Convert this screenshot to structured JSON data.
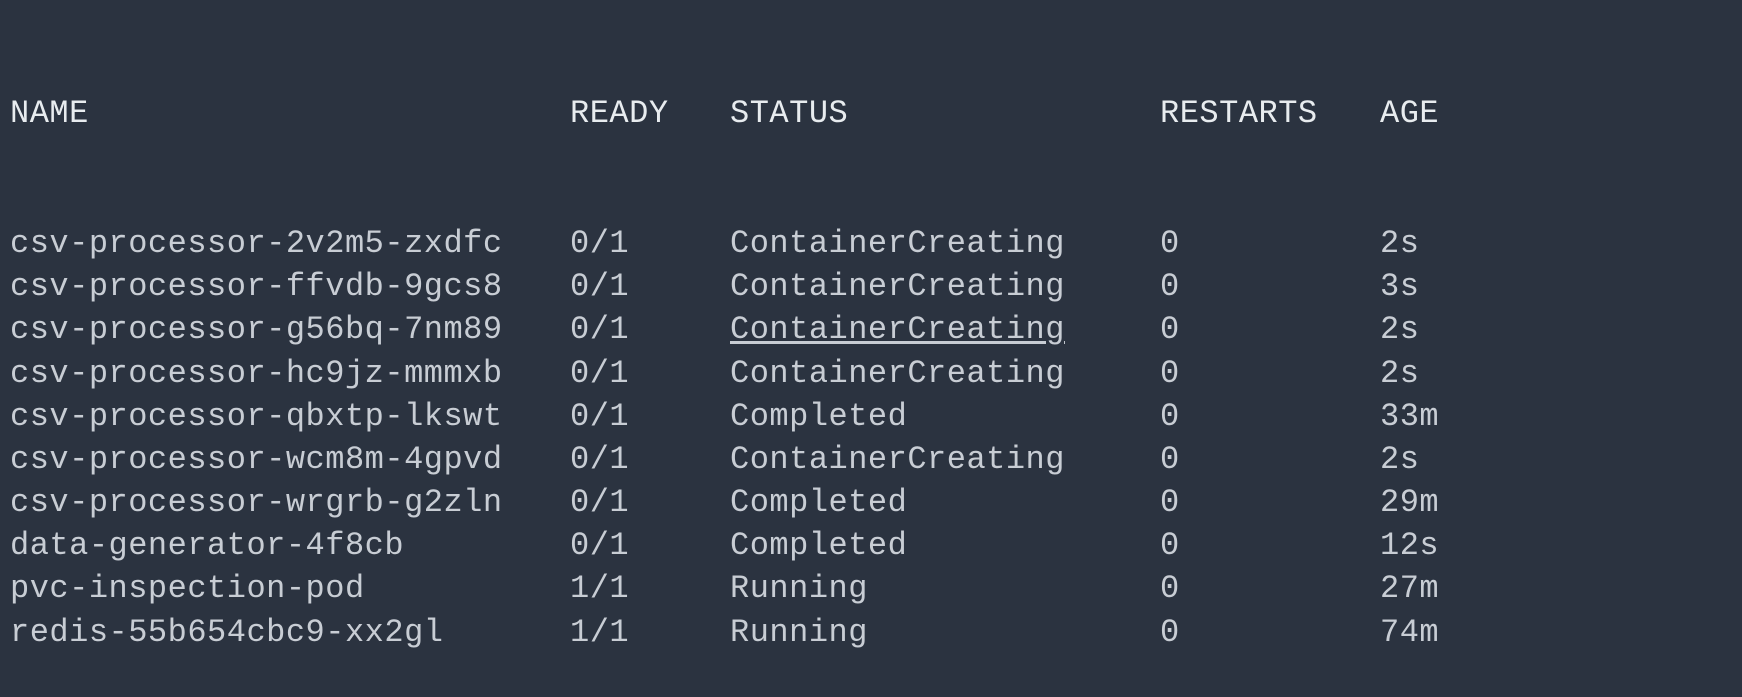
{
  "headers": {
    "name": "NAME",
    "ready": "READY",
    "status": "STATUS",
    "restarts": "RESTARTS",
    "age": "AGE"
  },
  "rows": [
    {
      "name": "csv-processor-2v2m5-zxdfc",
      "ready": "0/1",
      "status": "ContainerCreating",
      "restarts": "0",
      "age": "2s",
      "underline": false
    },
    {
      "name": "csv-processor-ffvdb-9gcs8",
      "ready": "0/1",
      "status": "ContainerCreating",
      "restarts": "0",
      "age": "3s",
      "underline": false
    },
    {
      "name": "csv-processor-g56bq-7nm89",
      "ready": "0/1",
      "status": "ContainerCreating",
      "restarts": "0",
      "age": "2s",
      "underline": true
    },
    {
      "name": "csv-processor-hc9jz-mmmxb",
      "ready": "0/1",
      "status": "ContainerCreating",
      "restarts": "0",
      "age": "2s",
      "underline": false
    },
    {
      "name": "csv-processor-qbxtp-lkswt",
      "ready": "0/1",
      "status": "Completed",
      "restarts": "0",
      "age": "33m",
      "underline": false
    },
    {
      "name": "csv-processor-wcm8m-4gpvd",
      "ready": "0/1",
      "status": "ContainerCreating",
      "restarts": "0",
      "age": "2s",
      "underline": false
    },
    {
      "name": "csv-processor-wrgrb-g2zln",
      "ready": "0/1",
      "status": "Completed",
      "restarts": "0",
      "age": "29m",
      "underline": false
    },
    {
      "name": "data-generator-4f8cb",
      "ready": "0/1",
      "status": "Completed",
      "restarts": "0",
      "age": "12s",
      "underline": false
    },
    {
      "name": "pvc-inspection-pod",
      "ready": "1/1",
      "status": "Running",
      "restarts": "0",
      "age": "27m",
      "underline": false
    },
    {
      "name": "redis-55b654cbc9-xx2gl",
      "ready": "1/1",
      "status": "Running",
      "restarts": "0",
      "age": "74m",
      "underline": false
    }
  ]
}
